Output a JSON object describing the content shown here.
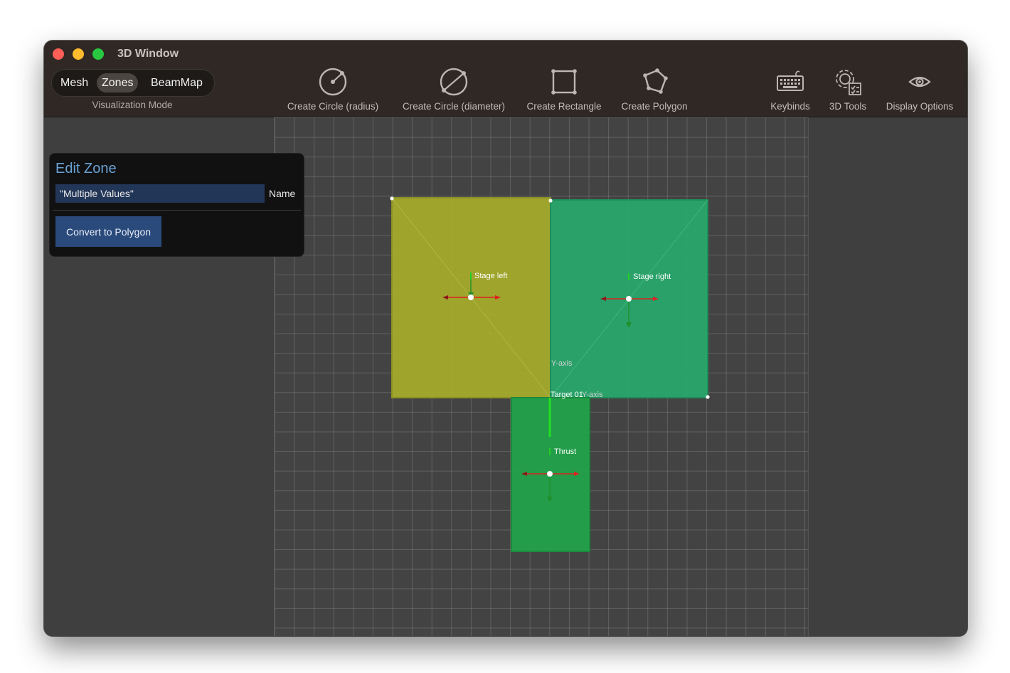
{
  "window": {
    "title": "3D Window"
  },
  "visualization": {
    "caption": "Visualization Mode",
    "modes": [
      "Mesh",
      "Zones",
      "BeamMap"
    ],
    "selected": "Zones"
  },
  "toolbar": {
    "create_circle_radius": "Create Circle (radius)",
    "create_circle_diameter": "Create Circle (diameter)",
    "create_rectangle": "Create Rectangle",
    "create_polygon": "Create Polygon",
    "keybinds": "Keybinds",
    "tools_3d": "3D Tools",
    "display_options": "Display Options"
  },
  "edit_zone": {
    "title": "Edit Zone",
    "name_value": "\"Multiple Values\"",
    "name_label": "Name",
    "convert_button": "Convert to Polygon"
  },
  "zones": [
    {
      "name": "Stage left",
      "color": "#a4aa2c"
    },
    {
      "name": "Stage right",
      "color": "#28a66c"
    },
    {
      "name": "Thrust",
      "color": "#22a24a"
    }
  ],
  "scene_labels": {
    "target": "Target 01",
    "y_axis": "Y-axis",
    "x_axis": "Y-axis"
  },
  "colors": {
    "axis_x": "#e02020",
    "axis_y": "#22d022",
    "panel_title": "#6aa2d4"
  }
}
